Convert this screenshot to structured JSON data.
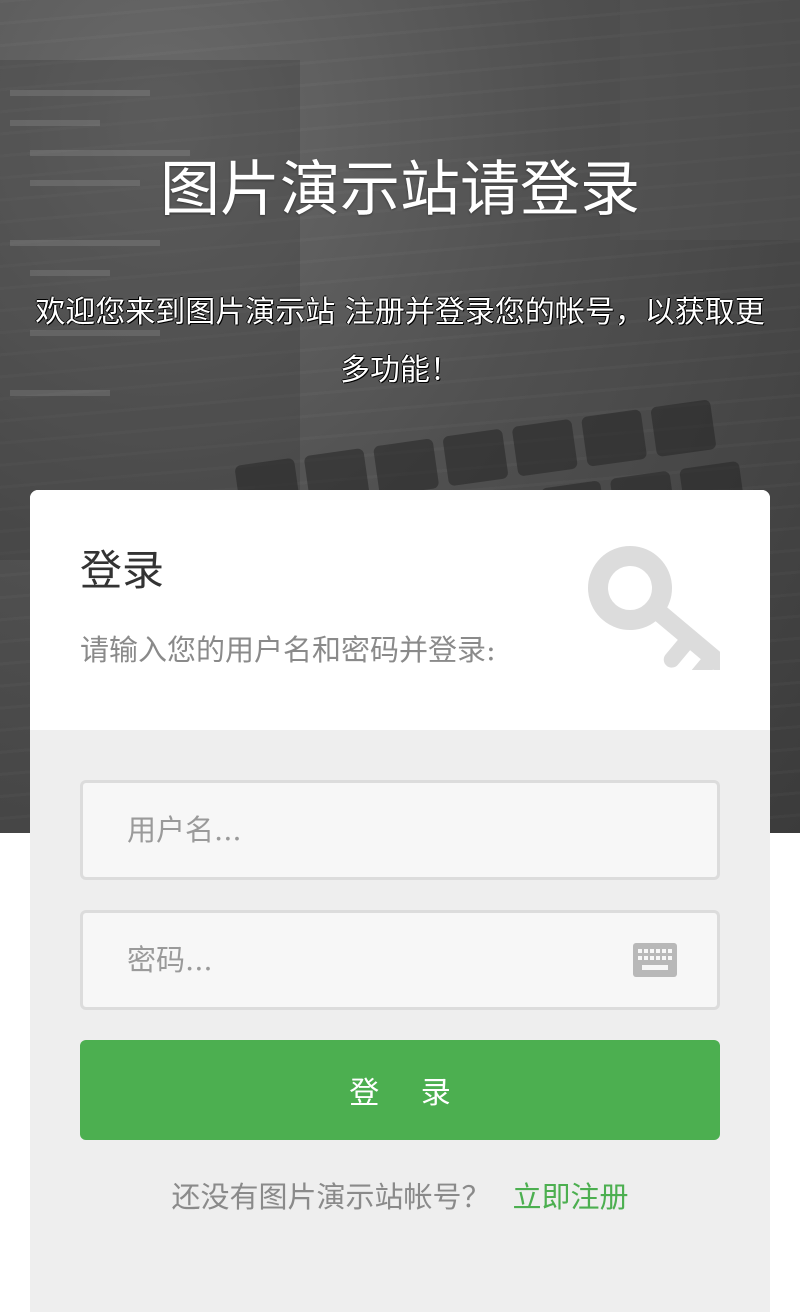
{
  "hero": {
    "title": "图片演示站请登录",
    "subtitle": "欢迎您来到图片演示站 注册并登录您的帐号，以获取更多功能！"
  },
  "login_card": {
    "title": "登录",
    "description": "请输入您的用户名和密码并登录:",
    "icon": "key-icon",
    "username": {
      "value": "",
      "placeholder": "用户名..."
    },
    "password": {
      "value": "",
      "placeholder": "密码...",
      "icon": "keyboard-icon"
    },
    "submit_label": "登 录",
    "register_prompt": "还没有图片演示站帐号？",
    "register_link": "立即注册"
  },
  "colors": {
    "accent": "#4caf50",
    "hero_bg": "#4a4a4a",
    "card_bg": "#eeeeee",
    "input_bg": "#f7f7f7",
    "muted_text": "#8a8a8a"
  }
}
